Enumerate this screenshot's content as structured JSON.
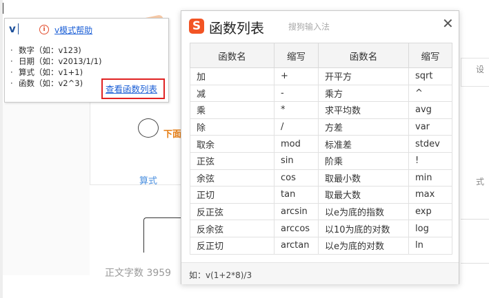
{
  "background": {
    "download_text": "下面",
    "calc_text": "算式",
    "word_count_label": "正文字数",
    "word_count_value": "3959",
    "right_text_1": "设",
    "right_text_2": "式"
  },
  "input": {
    "composition": "v"
  },
  "help_panel": {
    "link_label": "v模式帮助",
    "items": [
      "数字（如：v123)",
      "日期（如：v2013/1/1)",
      "算式（如：v1+1)",
      "函数（如：v2^3)"
    ],
    "view_list_label": "查看函数列表"
  },
  "dialog": {
    "title": "函数列表",
    "subtitle": "搜狗输入法",
    "headers": [
      "函数名",
      "缩写",
      "函数名",
      "缩写"
    ],
    "rows": [
      [
        "加",
        "+",
        "开平方",
        "sqrt"
      ],
      [
        "减",
        "-",
        "乘方",
        "^"
      ],
      [
        "乘",
        "*",
        "求平均数",
        "avg"
      ],
      [
        "除",
        "/",
        "方差",
        "var"
      ],
      [
        "取余",
        "mod",
        "标准差",
        "stdev"
      ],
      [
        "正弦",
        "sin",
        "阶乘",
        "!"
      ],
      [
        "余弦",
        "cos",
        "取最小数",
        "min"
      ],
      [
        "正切",
        "tan",
        "取最大数",
        "max"
      ],
      [
        "反正弦",
        "arcsin",
        "以e为底的指数",
        "exp"
      ],
      [
        "反余弦",
        "arccos",
        "以10为底的对数",
        "log"
      ],
      [
        "反正切",
        "arctan",
        "以e为底的对数",
        "ln"
      ]
    ],
    "footer_example": "如：v(1+2*8)/3"
  },
  "colors": {
    "accent_red": "#e02121",
    "link_blue": "#1a5ed6",
    "brand_orange": "#f25424"
  }
}
